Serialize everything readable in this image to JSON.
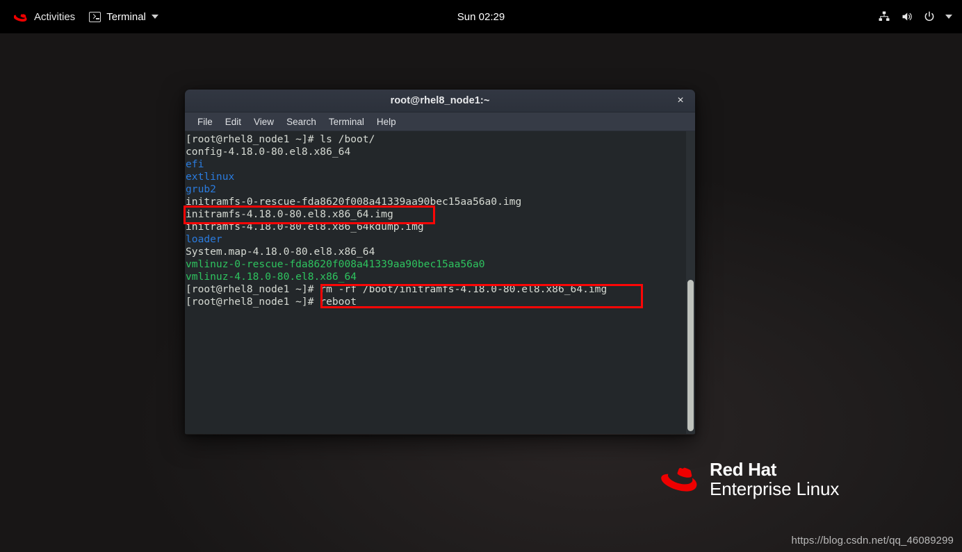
{
  "topbar": {
    "activities_label": "Activities",
    "app_label": "Terminal",
    "app_icon": "terminal-icon",
    "logo_icon": "redhat-logo-icon",
    "menu_caret_icon": "chevron-down-icon",
    "clock": "Sun 02:29",
    "tray": {
      "network_icon": "wired-network-icon",
      "volume_icon": "volume-speaker-icon",
      "power_icon": "power-icon",
      "expand_icon": "chevron-down-icon"
    }
  },
  "window": {
    "title": "root@rhel8_node1:~",
    "close_icon": "close-icon",
    "close_label": "×",
    "menu": [
      {
        "label": "File"
      },
      {
        "label": "Edit"
      },
      {
        "label": "View"
      },
      {
        "label": "Search"
      },
      {
        "label": "Terminal"
      },
      {
        "label": "Help"
      }
    ]
  },
  "terminal": {
    "prompt": "[root@rhel8_node1 ~]#",
    "lines": [
      {
        "type": "prompt",
        "prompt": "[root@rhel8_node1 ~]# ",
        "command": "ls /boot/"
      },
      {
        "type": "normal",
        "text": "config-4.18.0-80.el8.x86_64"
      },
      {
        "type": "dir",
        "text": "efi"
      },
      {
        "type": "dir",
        "text": "extlinux"
      },
      {
        "type": "dir",
        "text": "grub2"
      },
      {
        "type": "normal",
        "text": "initramfs-0-rescue-fda8620f008a41339aa90bec15aa56a0.img"
      },
      {
        "type": "normal",
        "text": "initramfs-4.18.0-80.el8.x86_64.img"
      },
      {
        "type": "normal",
        "text": "initramfs-4.18.0-80.el8.x86_64kdump.img"
      },
      {
        "type": "dir",
        "text": "loader"
      },
      {
        "type": "normal",
        "text": "System.map-4.18.0-80.el8.x86_64"
      },
      {
        "type": "exe",
        "text": "vmlinuz-0-rescue-fda8620f008a41339aa90bec15aa56a0"
      },
      {
        "type": "exe",
        "text": "vmlinuz-4.18.0-80.el8.x86_64"
      },
      {
        "type": "prompt",
        "prompt": "[root@rhel8_node1 ~]# ",
        "command": "rm -rf /boot/initramfs-4.18.0-80.el8.x86_64.img"
      },
      {
        "type": "prompt",
        "prompt": "[root@rhel8_node1 ~]# ",
        "command": "reboot"
      }
    ],
    "colors": {
      "background": "#23272a",
      "foreground": "#d6dad3",
      "directory": "#2a7bde",
      "executable": "#2ec45f"
    },
    "scrollbar": {
      "name": "vertical-scrollbar"
    }
  },
  "annotations": {
    "color": "#fc0606",
    "box1_target": "initramfs-4.18.0-80.el8.x86_64.img",
    "box2_target": "rm -rf /boot/initramfs-4.18.0-80.el8.x86_64.img / reboot"
  },
  "brand": {
    "logo_icon": "redhat-fedora-logo-icon",
    "line1": "Red Hat",
    "line2": "Enterprise Linux"
  },
  "watermark": {
    "text": "https://blog.csdn.net/qq_46089299"
  }
}
